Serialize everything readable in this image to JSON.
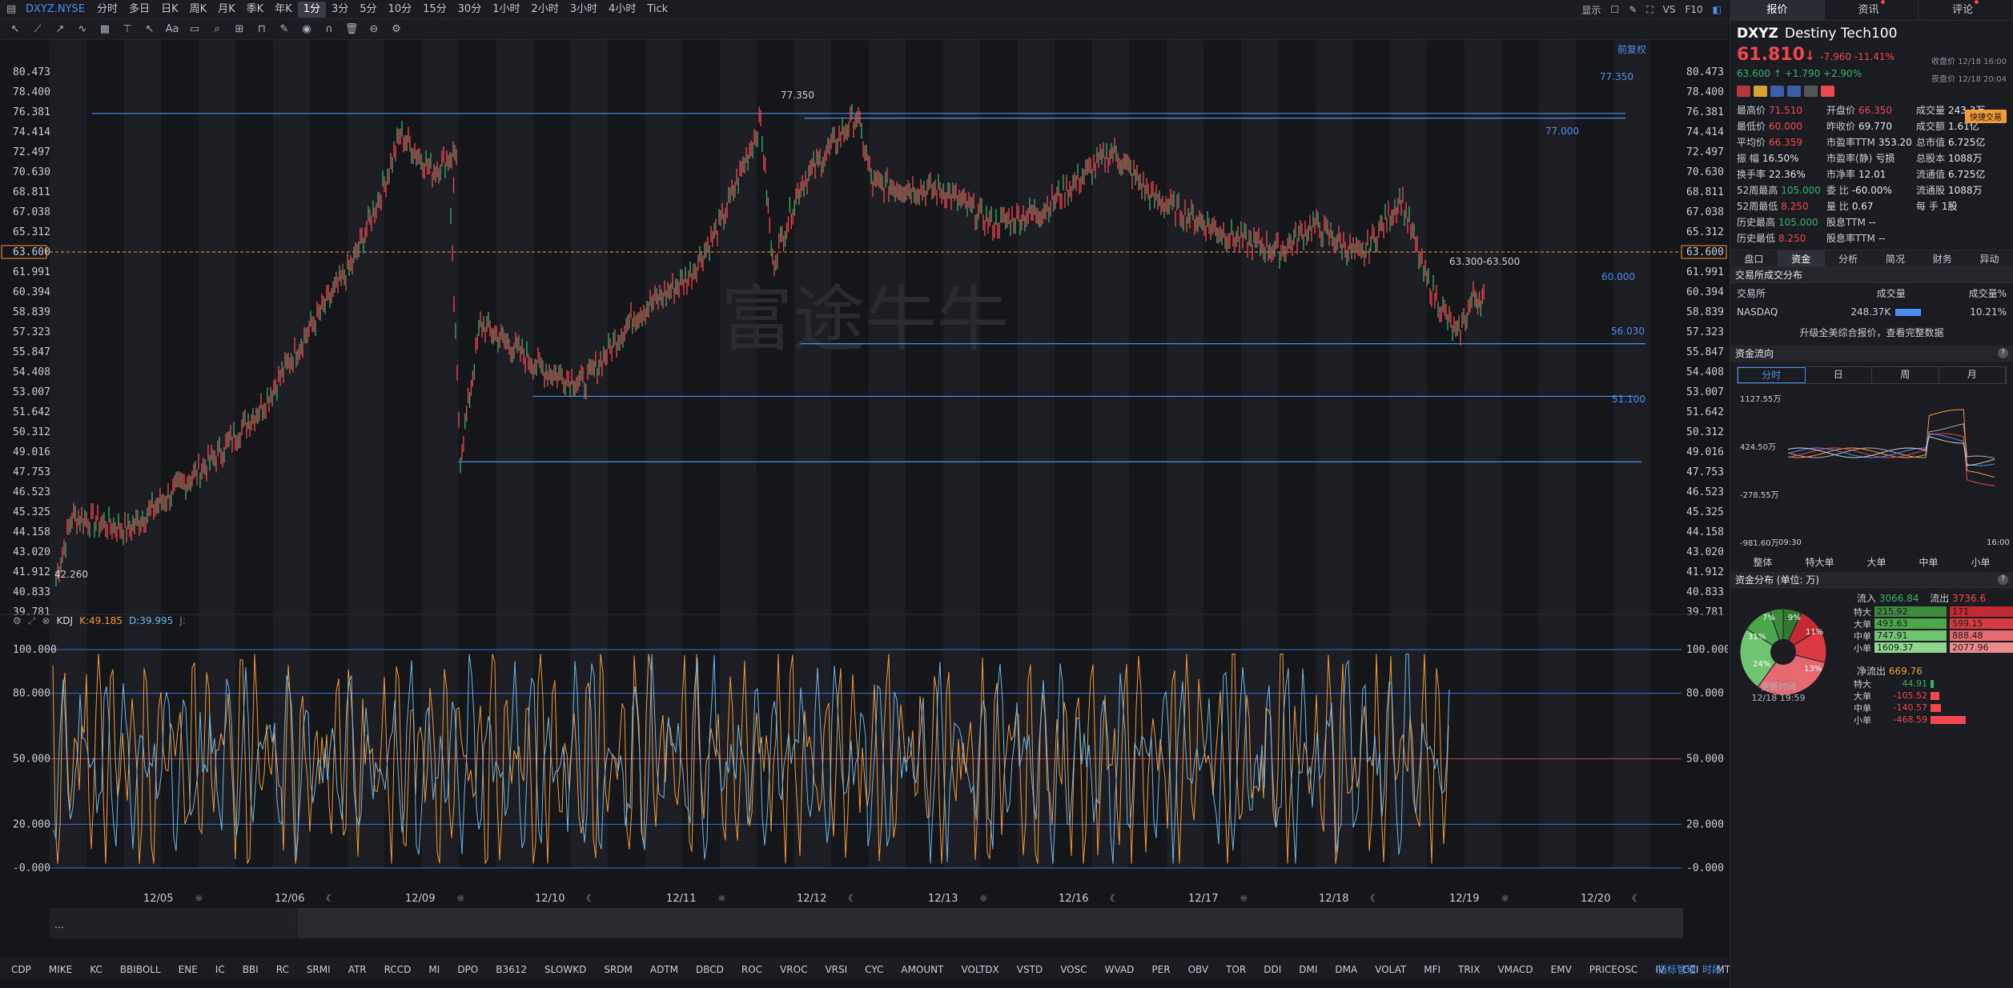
{
  "topbar": {
    "symbol": "DXYZ.NYSE",
    "periods": [
      "分时",
      "多日",
      "日K",
      "周K",
      "月K",
      "季K",
      "年K",
      "1分",
      "3分",
      "5分",
      "10分",
      "15分",
      "30分",
      "1小时",
      "2小时",
      "3小时",
      "4小时",
      "Tick"
    ],
    "active_period": "1分",
    "right": {
      "display": "显示",
      "vs": "VS",
      "f10": "F10"
    }
  },
  "chart": {
    "restore_label": "前复权",
    "y_ticks": [
      "80.473",
      "78.400",
      "76.381",
      "74.414",
      "72.497",
      "70.630",
      "68.811",
      "67.038",
      "65.312",
      "63.600",
      "61.991",
      "60.394",
      "58.839",
      "57.323",
      "55.847",
      "54.408",
      "53.007",
      "51.642",
      "50.312",
      "49.016",
      "47.753",
      "46.523",
      "45.325",
      "44.158",
      "43.020",
      "41.912",
      "40.833",
      "39.781"
    ],
    "current_price": "63.600",
    "annotations": {
      "high": "77.350",
      "low": "42.260",
      "range": "63.300-63.500"
    },
    "lines": [
      "77.350",
      "77.000",
      "60.000",
      "56.030",
      "51.100"
    ],
    "watermark": "富途牛牛",
    "kdj": {
      "label": "KDJ",
      "k": "K:49.185",
      "d": "D:39.995",
      "j": "J:"
    },
    "kdj_ticks": [
      "100.000",
      "80.000",
      "50.000",
      "20.000",
      "-0.000"
    ],
    "dates": [
      "12/05",
      "12/06",
      "12/09",
      "12/10",
      "12/11",
      "12/12",
      "12/13",
      "12/16",
      "12/17",
      "12/18",
      "12/19",
      "12/20"
    ]
  },
  "indicators": [
    "CDP",
    "MIKE",
    "KC",
    "BBIBOLL",
    "ENE",
    "IC",
    "BBI",
    "RC",
    "SRMI",
    "ATR",
    "RCCD",
    "MI",
    "DPO",
    "B3612",
    "SLOWKD",
    "SRDM",
    "ADTM",
    "DBCD",
    "ROC",
    "VROC",
    "VRSI",
    "CYC",
    "AMOUNT",
    "VOLTDX",
    "VSTD",
    "VOSC",
    "WVAD",
    "PER",
    "OBV",
    "TOR",
    "DDI",
    "DMI",
    "DMA",
    "VOLAT",
    "MFI",
    "TRIX",
    "VMACD",
    "EMV",
    "PRICEOSC",
    "IV",
    "CCI",
    "MTM"
  ],
  "indicator_manage": "指标管理",
  "timeshare": "时段",
  "panel": {
    "tabs": [
      "报价",
      "资讯",
      "评论"
    ],
    "ticker": "DXYZ",
    "name": "Destiny Tech100",
    "price": "61.810",
    "arrow": "↓",
    "change": "-7.960 -11.41%",
    "close_time": "收盘价 12/18 16:00",
    "after_price": "63.600",
    "after_change": "↑ +1.790 +2.90%",
    "after_time": "夜盘价 12/18 20:04",
    "quick_trade": "快捷交易",
    "quote": [
      [
        "最高价",
        "71.510",
        "up"
      ],
      [
        "开盘价",
        "66.350",
        "up"
      ],
      [
        "成交量",
        "243.3万",
        "wh"
      ],
      [
        "最低价",
        "60.000",
        "up"
      ],
      [
        "昨收价",
        "69.770",
        "wh"
      ],
      [
        "成交额",
        "1.61亿",
        "wh"
      ],
      [
        "平均价",
        "66.359",
        "up"
      ],
      [
        "市盈率TTM",
        "353.20",
        "wh"
      ],
      [
        "总市值",
        "6.725亿",
        "wh"
      ],
      [
        "振    幅",
        "16.50%",
        "wh"
      ],
      [
        "市盈率(静)",
        "亏损",
        "wh"
      ],
      [
        "总股本",
        "1088万",
        "wh"
      ],
      [
        "换手率",
        "22.36%",
        "wh"
      ],
      [
        "市净率",
        "12.01",
        "wh"
      ],
      [
        "流通值",
        "6.725亿",
        "wh"
      ],
      [
        "52周最高",
        "105.000",
        "dn"
      ],
      [
        "委    比",
        "-60.00%",
        "wh"
      ],
      [
        "流通股",
        "1088万",
        "wh"
      ],
      [
        "52周最低",
        "8.250",
        "up"
      ],
      [
        "量    比",
        "0.67",
        "wh"
      ],
      [
        "每    手",
        "1股",
        "wh"
      ],
      [
        "历史最高",
        "105.000",
        "dn"
      ],
      [
        "股息TTM",
        "--",
        "wh"
      ],
      [
        "",
        "",
        " "
      ],
      [
        "历史最低",
        "8.250",
        "up"
      ],
      [
        "股息率TTM",
        "--",
        "wh"
      ],
      [
        "",
        "",
        " "
      ]
    ],
    "subtabs": [
      "盘口",
      "资金",
      "分析",
      "简况",
      "财务",
      "异动"
    ],
    "active_subtab": "资金",
    "exchange": {
      "title": "交易所成交分布",
      "cols": [
        "交易所",
        "成交量",
        "成交量%"
      ],
      "row": [
        "NASDAQ",
        "248.37K",
        "10.21%"
      ],
      "upgrade": "升级全美综合报价，查看完整数据"
    },
    "flow": {
      "title": "资金流向",
      "tabs": [
        "分时",
        "日",
        "周",
        "月"
      ],
      "y": [
        "1127.55万",
        "424.50万",
        "-278.55万",
        "-981.60万"
      ],
      "x": [
        "09:30",
        "16:00"
      ],
      "legend": [
        "整体",
        "特大单",
        "大单",
        "中单",
        "小单"
      ]
    },
    "dist": {
      "title": "资金分布 (单位: 万)",
      "in_label": "流入",
      "in_total": "3066.84",
      "out_label": "流出",
      "out_total": "3736.6",
      "rows": [
        [
          "特大",
          "215.92",
          "171"
        ],
        [
          "大单",
          "493.63",
          "599.15"
        ],
        [
          "中单",
          "747.91",
          "888.48"
        ],
        [
          "小单",
          "1609.37",
          "2077.96"
        ]
      ],
      "pie": [
        "7%",
        "9%",
        "11%",
        "13%",
        "24%",
        "31%"
      ],
      "update_label": "更新时间",
      "update_time": "12/18 19:59",
      "net_label": "净流出",
      "net_total": "669.76",
      "net_rows": [
        [
          "特大",
          "44.91"
        ],
        [
          "大单",
          "-105.52"
        ],
        [
          "中单",
          "-140.57"
        ],
        [
          "小单",
          "-468.59"
        ]
      ]
    }
  },
  "colors": {
    "up": "#f0474f",
    "down": "#2fb36e",
    "accent": "#4b8ef0",
    "k": "#f29a38",
    "d": "#6eb6e6"
  }
}
